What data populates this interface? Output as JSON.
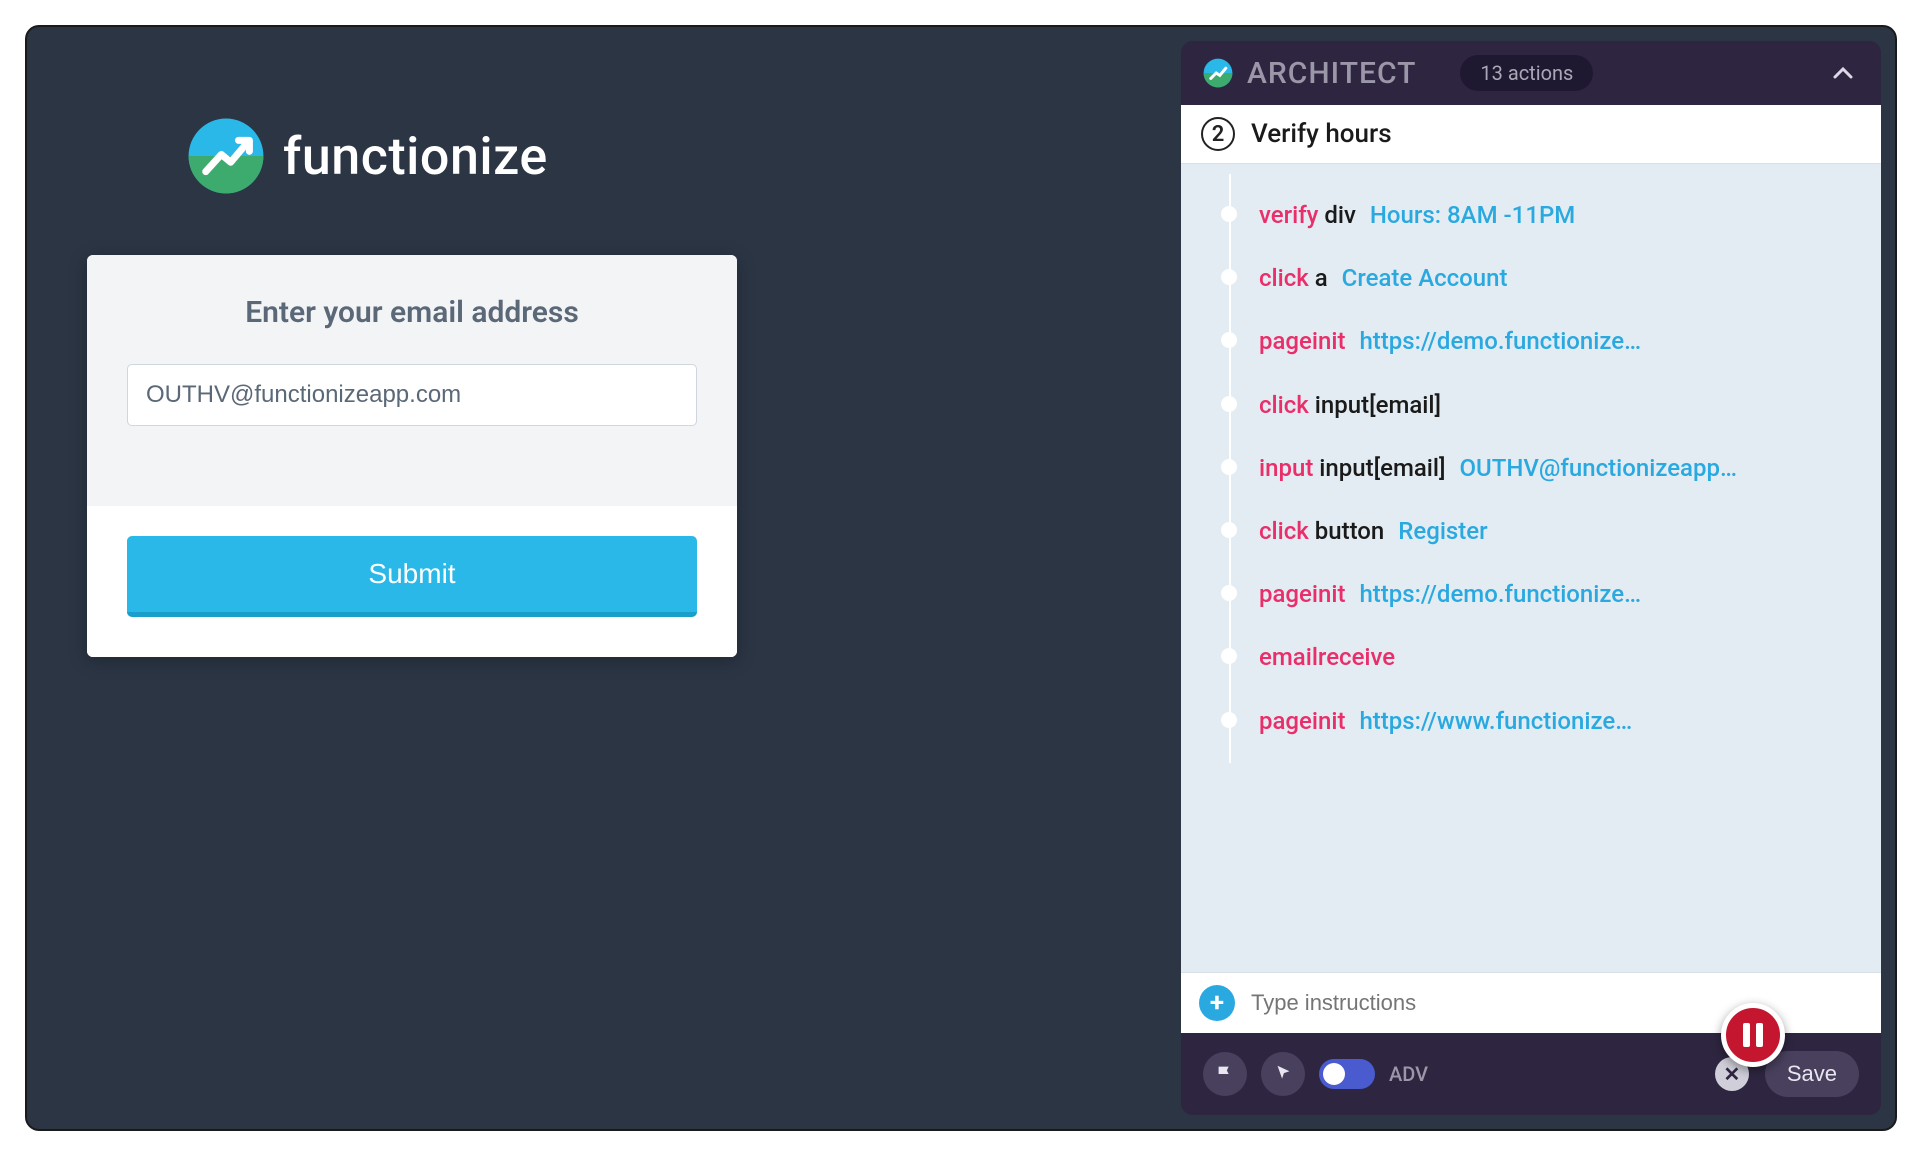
{
  "logo_text": "functionize",
  "form": {
    "title": "Enter your email address",
    "email_value": "OUTHV@functionizeapp.com",
    "submit_label": "Submit"
  },
  "architect": {
    "title": "ARCHITECT",
    "badge": "13 actions",
    "step_num": "2",
    "step_title": "Verify hours",
    "steps": [
      {
        "action": "verify",
        "elem": "div",
        "val": "Hours: 8AM -11PM"
      },
      {
        "action": "click",
        "elem": "a",
        "val": "Create Account"
      },
      {
        "action": "pageinit",
        "elem": "",
        "val": "https://demo.functionize…"
      },
      {
        "action": "click",
        "elem": "input[email]",
        "val": ""
      },
      {
        "action": "input",
        "elem": "input[email]",
        "val": "OUTHV@functionizeapp…"
      },
      {
        "action": "click",
        "elem": "button",
        "val": "Register"
      },
      {
        "action": "pageinit",
        "elem": "",
        "val": "https://demo.functionize…"
      },
      {
        "action": "emailreceive",
        "elem": "",
        "val": ""
      },
      {
        "action": "pageinit",
        "elem": "",
        "val": "https://www.functionize…"
      }
    ],
    "instructions_placeholder": "Type instructions",
    "adv_label": "ADV",
    "save_label": "Save"
  }
}
